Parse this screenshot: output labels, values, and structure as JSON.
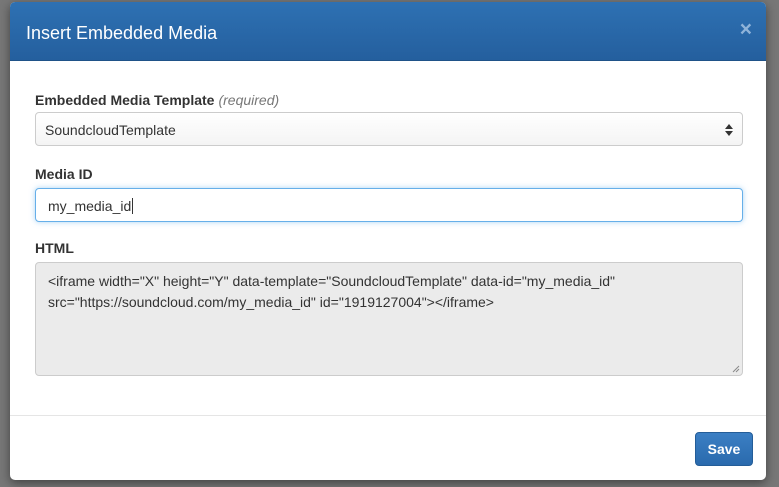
{
  "dialog": {
    "title": "Insert Embedded Media",
    "close_label": "×"
  },
  "template_field": {
    "label": "Embedded Media Template",
    "required_note": "(required)",
    "selected_value": "SoundcloudTemplate"
  },
  "media_id_field": {
    "label": "Media ID",
    "value": "my_media_id"
  },
  "html_field": {
    "label": "HTML",
    "value": "<iframe width=\"X\" height=\"Y\" data-template=\"SoundcloudTemplate\" data-id=\"my_media_id\"\nsrc=\"https://soundcloud.com/my_media_id\" id=\"1919127004\"></iframe>"
  },
  "footer": {
    "save_label": "Save"
  },
  "colors": {
    "header": "#2e71b3",
    "primary_button": "#3b7fc4",
    "focus_border": "#66afe9"
  }
}
